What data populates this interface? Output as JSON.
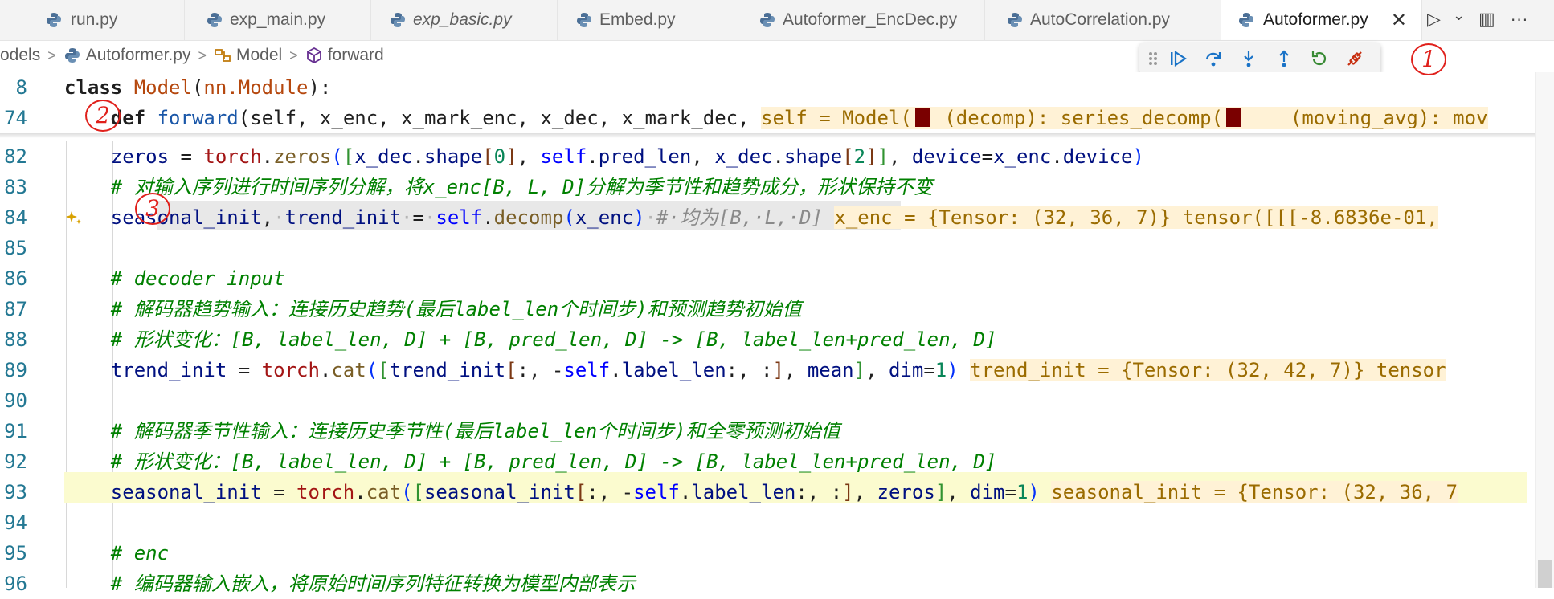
{
  "tabs": [
    {
      "label": "run.py",
      "italic": false,
      "active": false
    },
    {
      "label": "exp_main.py",
      "italic": false,
      "active": false
    },
    {
      "label": "exp_basic.py",
      "italic": true,
      "active": false
    },
    {
      "label": "Embed.py",
      "italic": false,
      "active": false
    },
    {
      "label": "Autoformer_EncDec.py",
      "italic": false,
      "active": false
    },
    {
      "label": "AutoCorrelation.py",
      "italic": false,
      "active": false
    },
    {
      "label": "Autoformer.py",
      "italic": false,
      "active": true
    }
  ],
  "tab_close_glyph": "✕",
  "tab_actions": {
    "run": "▷",
    "run_dropdown": "⌄",
    "split": "▥",
    "more": "···"
  },
  "breadcrumb": {
    "folder": "odels",
    "file": "Autoformer.py",
    "class": "Model",
    "method": "forward"
  },
  "debug_toolbar": {
    "icons": [
      "drag-handle-icon",
      "continue-icon",
      "step-over-icon",
      "step-into-icon",
      "step-out-icon",
      "restart-icon",
      "disconnect-icon"
    ]
  },
  "annotations": [
    "1",
    "2",
    "3"
  ],
  "sticky": {
    "l8": {
      "num": "8",
      "kw": "class",
      "name": "Model",
      "args": "nn.Module"
    },
    "l74": {
      "num": "74",
      "kw": "def",
      "name": "forward",
      "params": "self, x_enc, x_mark_enc, x_dec, x_mark_dec,",
      "inline_a": "self = Model(",
      "inline_b": " (decomp): series_decomp(",
      "inline_c": "    (moving_avg): mov"
    }
  },
  "lines": {
    "l82": {
      "num": "82"
    },
    "l83": {
      "num": "83",
      "comment": "# 对输入序列进行时间序列分解，将x_enc[B, L, D]分解为季节性和趋势成分，形状保持不变"
    },
    "l84": {
      "num": "84",
      "comment": "#·均为[B,·L,·D]",
      "inline": "x_enc = {Tensor: (32, 36, 7)} tensor([[[-8.6836e-01,"
    },
    "l85": {
      "num": "85"
    },
    "l86": {
      "num": "86",
      "comment": "# decoder input"
    },
    "l87": {
      "num": "87",
      "comment": "# 解码器趋势输入：连接历史趋势(最后label_len个时间步)和预测趋势初始值"
    },
    "l88": {
      "num": "88",
      "comment": "# 形状变化：[B, label_len, D] + [B, pred_len, D] -> [B, label_len+pred_len, D]"
    },
    "l89": {
      "num": "89",
      "inline": "trend_init = {Tensor: (32, 42, 7)} tensor"
    },
    "l90": {
      "num": "90"
    },
    "l91": {
      "num": "91",
      "comment": "# 解码器季节性输入：连接历史季节性(最后label_len个时间步)和全零预测初始值"
    },
    "l92": {
      "num": "92",
      "comment": "# 形状变化：[B, label_len, D] + [B, pred_len, D] -> [B, label_len+pred_len, D]"
    },
    "l93": {
      "num": "93",
      "inline": "seasonal_init = {Tensor: (32, 36, 7"
    },
    "l94": {
      "num": "94"
    },
    "l95": {
      "num": "95",
      "comment": "# enc"
    },
    "l96": {
      "num": "96",
      "comment": "# 编码器输入嵌入，将原始时间序列特征转换为模型内部表示"
    }
  },
  "colors": {
    "accent_red": "#e0201b",
    "line_highlight": "#fbfbcf",
    "line_number": "#237893"
  }
}
